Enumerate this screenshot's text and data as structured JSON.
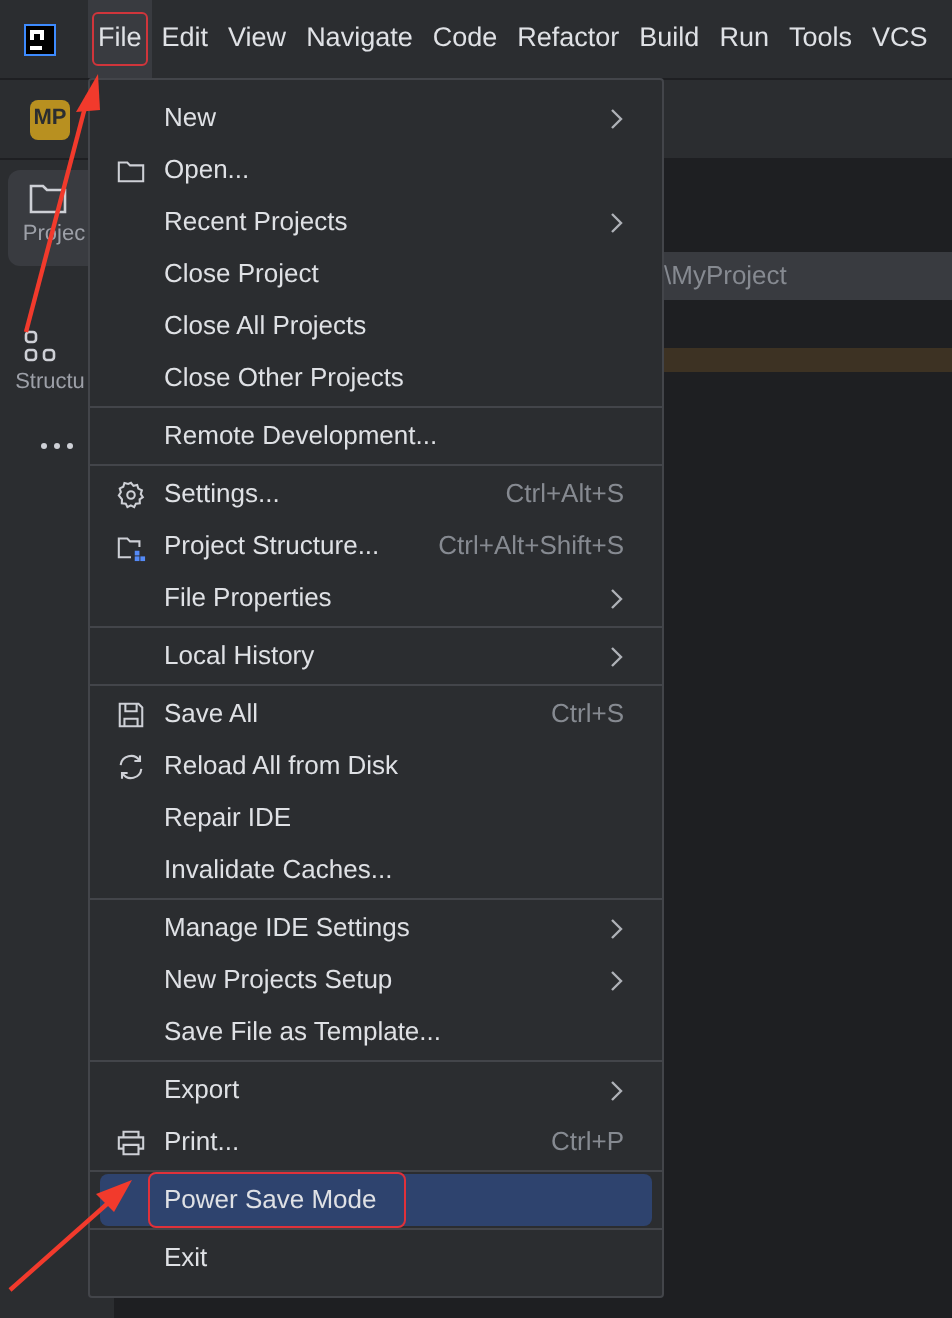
{
  "menubar": {
    "items": [
      {
        "label": "File",
        "selected": true,
        "annotated": true
      },
      {
        "label": "Edit",
        "selected": false,
        "annotated": false
      },
      {
        "label": "View",
        "selected": false,
        "annotated": false
      },
      {
        "label": "Navigate",
        "selected": false,
        "annotated": false
      },
      {
        "label": "Code",
        "selected": false,
        "annotated": false
      },
      {
        "label": "Refactor",
        "selected": false,
        "annotated": false
      },
      {
        "label": "Build",
        "selected": false,
        "annotated": false
      },
      {
        "label": "Run",
        "selected": false,
        "annotated": false
      },
      {
        "label": "Tools",
        "selected": false,
        "annotated": false
      },
      {
        "label": "VCS",
        "selected": false,
        "annotated": false
      }
    ]
  },
  "project_badge": "MP",
  "sidebar": {
    "items": [
      {
        "label": "Projec",
        "selected": true
      },
      {
        "label": "Structu",
        "selected": false
      }
    ]
  },
  "path_field": {
    "value": "\\MyProject"
  },
  "file_menu": {
    "groups": [
      [
        {
          "label": "New",
          "submenu": true
        },
        {
          "label": "Open...",
          "submenu": false
        },
        {
          "label": "Recent Projects",
          "submenu": true
        },
        {
          "label": "Close Project",
          "submenu": false
        },
        {
          "label": "Close All Projects",
          "submenu": false
        },
        {
          "label": "Close Other Projects",
          "submenu": false
        }
      ],
      [
        {
          "label": "Remote Development...",
          "submenu": false
        }
      ],
      [
        {
          "label": "Settings...",
          "shortcut": "Ctrl+Alt+S",
          "submenu": false
        },
        {
          "label": "Project Structure...",
          "shortcut": "Ctrl+Alt+Shift+S",
          "submenu": false
        },
        {
          "label": "File Properties",
          "submenu": true
        }
      ],
      [
        {
          "label": "Local History",
          "submenu": true
        }
      ],
      [
        {
          "label": "Save All",
          "shortcut": "Ctrl+S",
          "submenu": false
        },
        {
          "label": "Reload All from Disk",
          "submenu": false
        },
        {
          "label": "Repair IDE",
          "submenu": false
        },
        {
          "label": "Invalidate Caches...",
          "submenu": false
        }
      ],
      [
        {
          "label": "Manage IDE Settings",
          "submenu": true
        },
        {
          "label": "New Projects Setup",
          "submenu": true
        },
        {
          "label": "Save File as Template...",
          "submenu": false
        }
      ],
      [
        {
          "label": "Export",
          "submenu": true
        },
        {
          "label": "Print...",
          "shortcut": "Ctrl+P",
          "submenu": false
        }
      ],
      [
        {
          "label": "Power Save Mode",
          "submenu": false,
          "selected": true,
          "annotated": true
        }
      ],
      [
        {
          "label": "Exit",
          "submenu": false
        }
      ]
    ]
  }
}
